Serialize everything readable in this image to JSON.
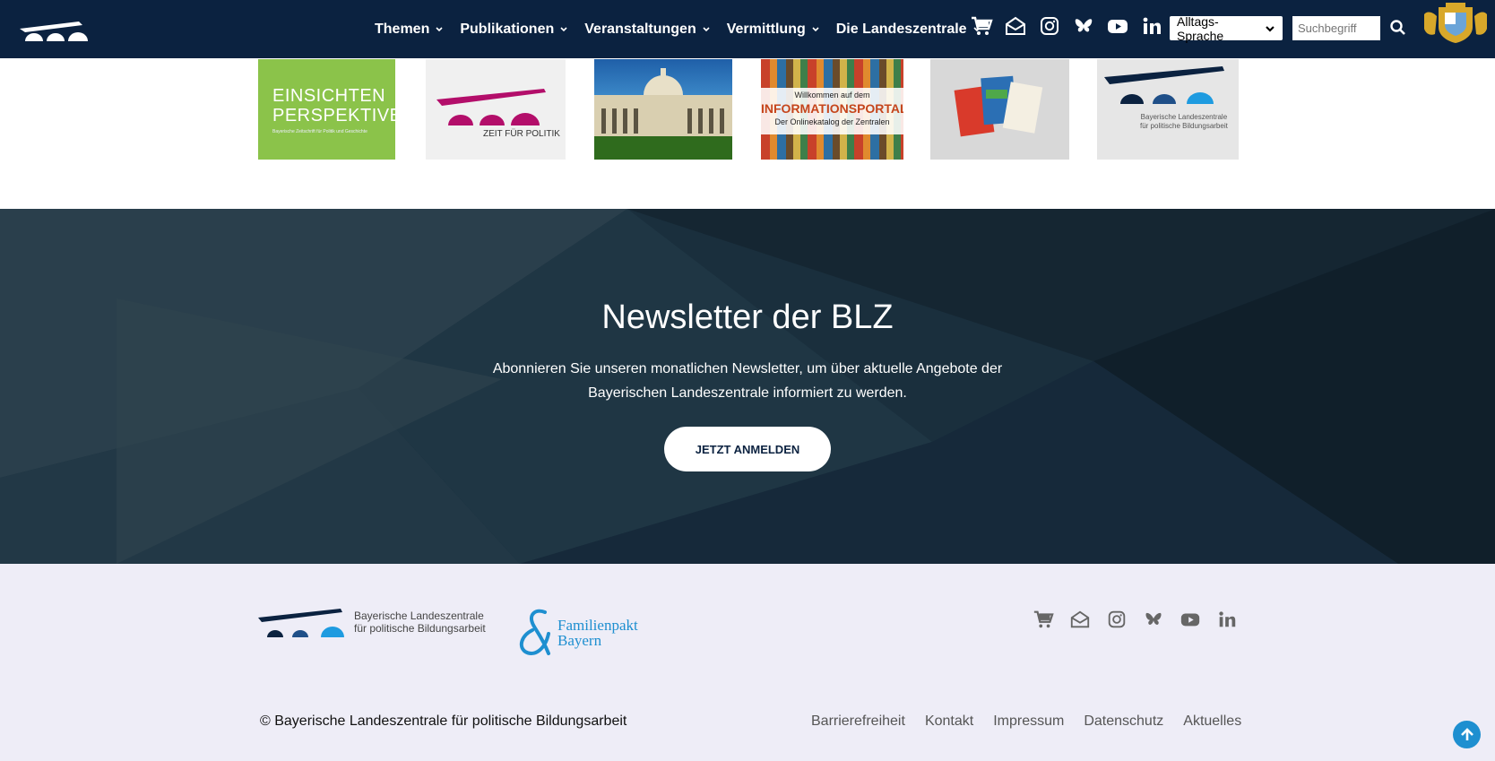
{
  "header": {
    "nav": [
      {
        "label": "Themen"
      },
      {
        "label": "Publikationen"
      },
      {
        "label": "Veranstaltungen"
      },
      {
        "label": "Vermittlung"
      },
      {
        "label": "Die Landeszentrale"
      }
    ],
    "icons": [
      "cart-icon",
      "newsletter-mail-icon",
      "instagram-icon",
      "bluesky-icon",
      "youtube-icon",
      "linkedin-icon"
    ],
    "language_select": "Alltags-Sprache",
    "search_placeholder": "Suchbegriff",
    "colors": {
      "bar": "#0b2240"
    }
  },
  "tiles": {
    "einsichten": {
      "line1": "EINSICHTEN",
      "line2": "PERSPEKTIVEN",
      "sub": "Bayerische Zeitschrift für Politik und Geschichte"
    },
    "zeit": {
      "label": "ZEIT FÜR POLITIK"
    },
    "portal": {
      "line1": "Willkommen auf dem",
      "line2": "INFORMATIONSPORTAL",
      "line3": "Der Onlinekatalog der Zentralen"
    },
    "blz": {
      "line1": "Bayerische Landeszentrale",
      "line2": "für politische Bildungsarbeit"
    }
  },
  "newsletter": {
    "title": "Newsletter der BLZ",
    "text": "Abonnieren Sie unseren monatlichen Newsletter, um über aktuelle Angebote der Bayerischen Landeszentrale informiert zu werden.",
    "button": "JETZT ANMELDEN"
  },
  "footer": {
    "logo_line1": "Bayerische Landeszentrale",
    "logo_line2": "für politische Bildungsarbeit",
    "familienpakt_line1": "Familienpakt",
    "familienpakt_line2": "Bayern",
    "copyright": "© Bayerische Landeszentrale für politische Bildungsarbeit",
    "links": [
      "Barrierefreiheit",
      "Kontakt",
      "Impressum",
      "Datenschutz",
      "Aktuelles"
    ],
    "colors": {
      "background": "#eeedf7",
      "accent": "#1e8fd0"
    }
  }
}
